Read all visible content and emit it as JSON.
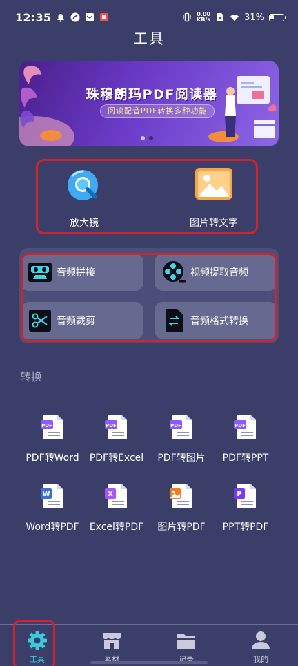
{
  "status_bar": {
    "time": "12:35",
    "net_speed_value": "0.00",
    "net_speed_unit": "KB/s",
    "battery_text": "31%",
    "battery_level": 0.31
  },
  "page": {
    "title": "工具"
  },
  "banner": {
    "title": "珠穆朗玛PDF阅读器",
    "subtitle": "阅读配音PDF转换多种功能",
    "page_count": 2,
    "active_page": 2
  },
  "quick_tools": [
    {
      "label": "放大镜",
      "icon": "magnifier-icon"
    },
    {
      "label": "图片转文字",
      "icon": "image-icon"
    }
  ],
  "audio_tools": [
    {
      "label": "音频拼接",
      "icon": "cassette-icon"
    },
    {
      "label": "视频提取音频",
      "icon": "film-reel-icon"
    },
    {
      "label": "音频裁剪",
      "icon": "scissors-icon"
    },
    {
      "label": "音频格式转换",
      "icon": "file-convert-icon"
    }
  ],
  "conversion": {
    "section_label": "转换",
    "items": [
      {
        "label": "PDF转Word",
        "badge": "PDF",
        "color": "#8b5cf6"
      },
      {
        "label": "PDF转Excel",
        "badge": "PDF",
        "color": "#8b5cf6"
      },
      {
        "label": "PDF转图片",
        "badge": "PDF",
        "color": "#8b5cf6"
      },
      {
        "label": "PDF转PPT",
        "badge": "PDF",
        "color": "#8b5cf6"
      },
      {
        "label": "Word转PDF",
        "badge": "W",
        "color": "#3b6fd8"
      },
      {
        "label": "Excel转PDF",
        "badge": "X",
        "color": "#a855f7"
      },
      {
        "label": "图片转PDF",
        "badge": "img",
        "color": "#f07d1f"
      },
      {
        "label": "PPT转PDF",
        "badge": "P",
        "color": "#7c3aed"
      }
    ]
  },
  "bottom_nav": [
    {
      "label": "工具",
      "icon": "gear-icon",
      "active": true
    },
    {
      "label": "素材",
      "icon": "store-icon",
      "active": false
    },
    {
      "label": "记录",
      "icon": "folder-icon",
      "active": false
    },
    {
      "label": "我的",
      "icon": "user-icon",
      "active": false
    }
  ],
  "colors": {
    "background": "#3b3e69",
    "tile": "#676a90",
    "highlight_border": "#d2232a",
    "accent": "#3bc9db"
  }
}
